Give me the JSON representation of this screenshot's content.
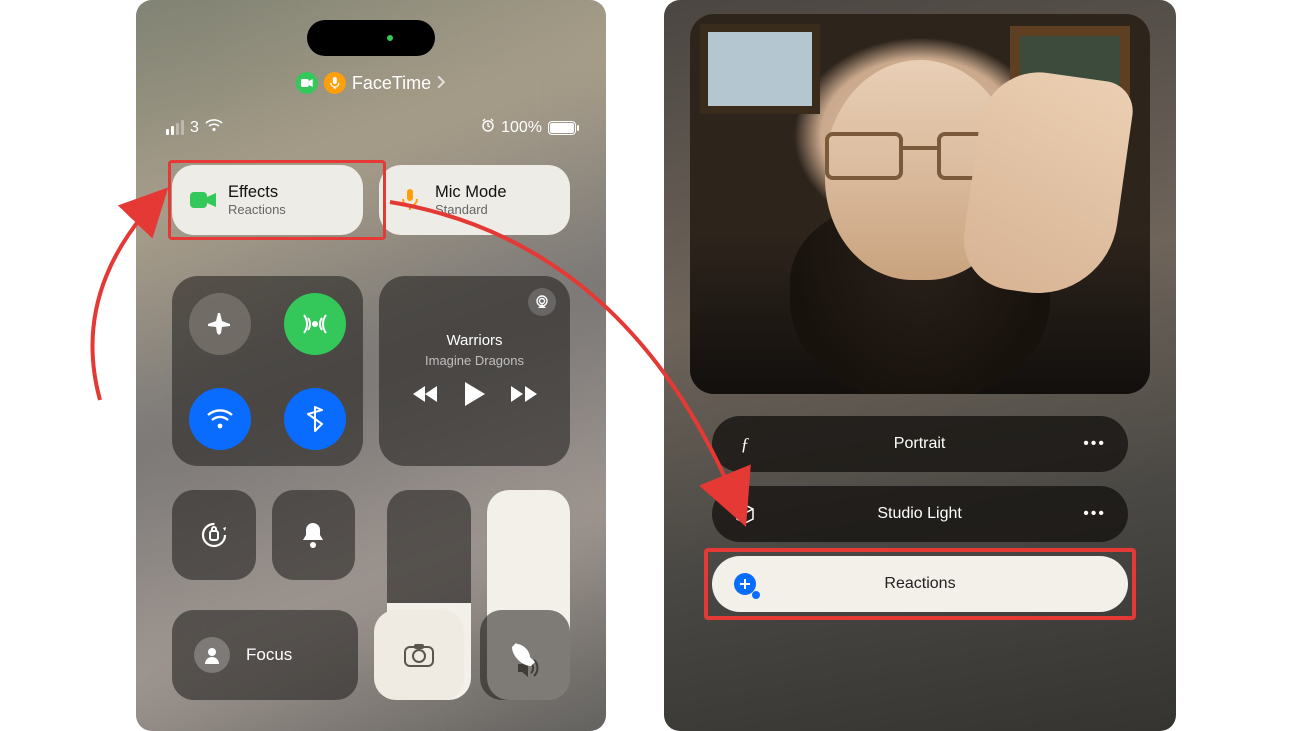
{
  "colors": {
    "highlight": "#e53935",
    "green": "#34c759",
    "orange": "#ff9f0a",
    "blue": "#0a6cff"
  },
  "facetime_pill": {
    "app": "FaceTime"
  },
  "status": {
    "carrier": "3",
    "battery_pct": "100%"
  },
  "tiles": {
    "effects": {
      "title": "Effects",
      "subtitle": "Reactions"
    },
    "mic": {
      "title": "Mic Mode",
      "subtitle": "Standard"
    }
  },
  "media": {
    "title": "Warriors",
    "artist": "Imagine Dragons"
  },
  "row4": {
    "focus": "Focus"
  },
  "effects_panel": {
    "items": [
      {
        "label": "Portrait",
        "icon": "aperture",
        "more": true,
        "active": false
      },
      {
        "label": "Studio Light",
        "icon": "cube",
        "more": true,
        "active": false
      },
      {
        "label": "Reactions",
        "icon": "blue-plus",
        "more": false,
        "active": true
      }
    ]
  },
  "annotations": {
    "highlight_effects_tile": true,
    "highlight_reactions_item": true
  }
}
